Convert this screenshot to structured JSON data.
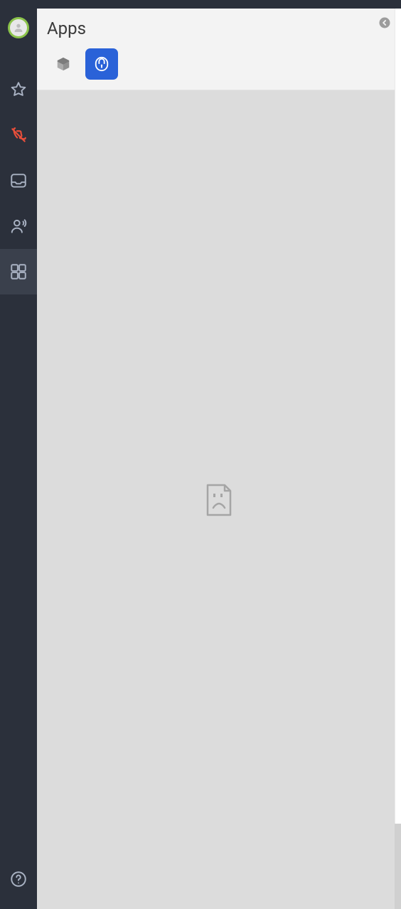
{
  "panel": {
    "title": "Apps"
  },
  "sidebar": {
    "items": [
      {
        "name": "favorites",
        "icon": "star"
      },
      {
        "name": "calls",
        "icon": "phone-off"
      },
      {
        "name": "inbox",
        "icon": "inbox"
      },
      {
        "name": "contacts",
        "icon": "person-speak"
      },
      {
        "name": "apps",
        "icon": "grid"
      }
    ],
    "activeIndex": 4
  },
  "tabs": [
    {
      "name": "box",
      "icon": "cube",
      "selected": false
    },
    {
      "name": "secure",
      "icon": "lock",
      "selected": true
    }
  ],
  "content": {
    "state": "error"
  },
  "colors": {
    "accent": "#2a62d8",
    "sidebar_bg": "#2b303b",
    "danger": "#e94f3b",
    "avatar_ring": "#8bc34a"
  }
}
